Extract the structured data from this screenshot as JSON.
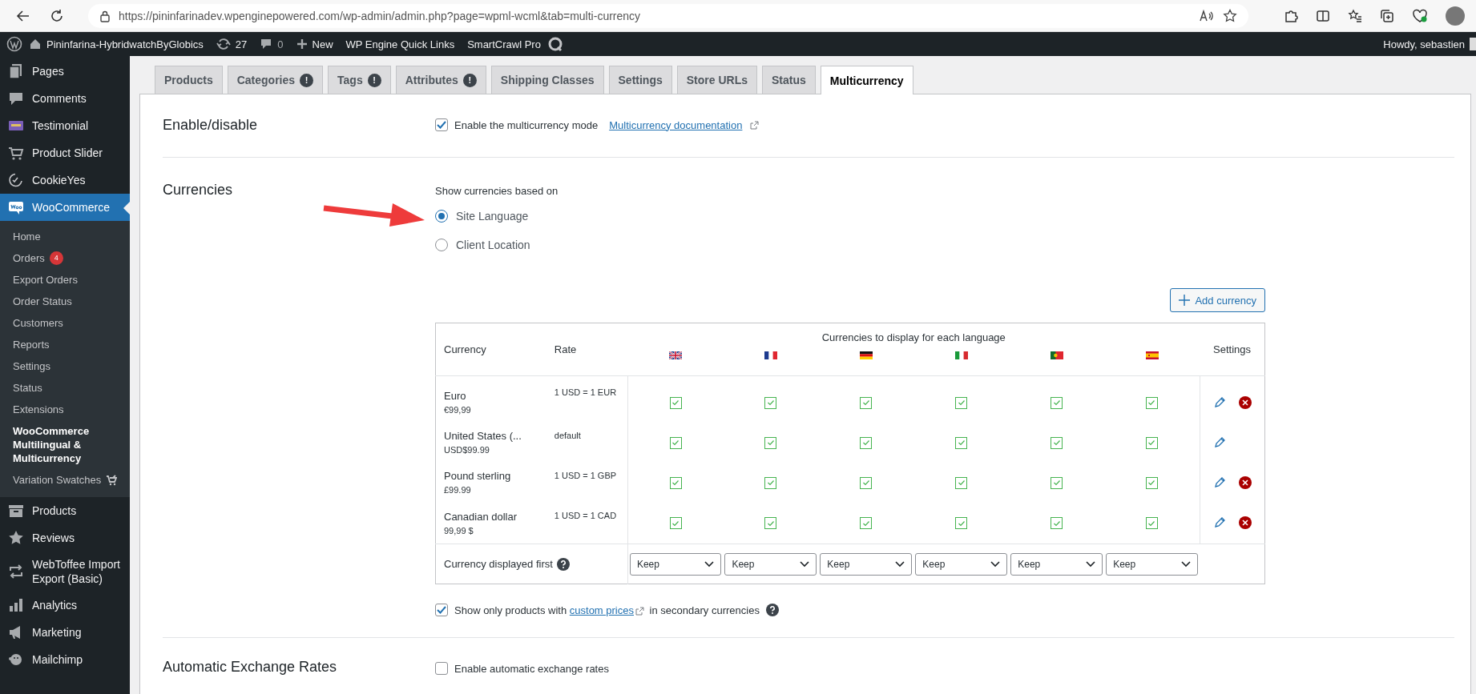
{
  "browser": {
    "url": "https://pininfarinadev.wpenginepowered.com/wp-admin/admin.php?page=wpml-wcml&tab=multi-currency"
  },
  "admin_bar": {
    "site_name": "Pininfarina-HybridwatchByGlobics",
    "updates": "27",
    "comments": "0",
    "new": "New",
    "links": [
      "WP Engine Quick Links",
      "SmartCrawl Pro"
    ],
    "greeting": "Howdy, sebastien"
  },
  "sidebar": {
    "items": [
      {
        "label": "Pages",
        "selected": false
      },
      {
        "label": "Comments",
        "selected": false
      },
      {
        "label": "Testimonial",
        "selected": false
      },
      {
        "label": "Product Slider",
        "selected": false
      },
      {
        "label": "CookieYes",
        "selected": false
      },
      {
        "label": "WooCommerce",
        "selected": true,
        "children": [
          {
            "label": "Home",
            "selected": false
          },
          {
            "label": "Orders",
            "selected": false,
            "badge": "4"
          },
          {
            "label": "Export Orders",
            "selected": false
          },
          {
            "label": "Order Status",
            "selected": false
          },
          {
            "label": "Customers",
            "selected": false
          },
          {
            "label": "Reports",
            "selected": false
          },
          {
            "label": "Settings",
            "selected": false
          },
          {
            "label": "Status",
            "selected": false
          },
          {
            "label": "Extensions",
            "selected": false
          },
          {
            "label": "WooCommerce Multilingual & Multicurrency",
            "selected": true
          },
          {
            "label": "Variation Swatches",
            "selected": false
          }
        ]
      },
      {
        "label": "Products",
        "selected": false
      },
      {
        "label": "Reviews",
        "selected": false
      },
      {
        "label": "WebToffee Import Export (Basic)",
        "selected": false
      },
      {
        "label": "Analytics",
        "selected": false
      },
      {
        "label": "Marketing",
        "selected": false
      },
      {
        "label": "Mailchimp",
        "selected": false
      }
    ]
  },
  "tabs": [
    {
      "label": "Products",
      "selected": false
    },
    {
      "label": "Categories",
      "selected": false,
      "badge": "!"
    },
    {
      "label": "Tags",
      "selected": false,
      "badge": "!"
    },
    {
      "label": "Attributes",
      "selected": false,
      "badge": "!"
    },
    {
      "label": "Shipping Classes",
      "selected": false
    },
    {
      "label": "Settings",
      "selected": false
    },
    {
      "label": "Store URLs",
      "selected": false
    },
    {
      "label": "Status",
      "selected": false
    },
    {
      "label": "Multicurrency",
      "selected": true
    }
  ],
  "enable": {
    "heading": "Enable/disable",
    "label": "Enable the multicurrency mode",
    "checked": true,
    "link": "Multicurrency documentation"
  },
  "currencies": {
    "heading": "Currencies",
    "mode_label": "Show currencies based on",
    "modes": [
      {
        "label": "Site Language",
        "selected": true
      },
      {
        "label": "Client Location",
        "selected": false
      }
    ],
    "add_button": "Add currency",
    "table": {
      "columns": [
        "Currency",
        "Rate"
      ],
      "languages_heading": "Currencies to display for each language",
      "settings_heading": "Settings",
      "rows": [
        {
          "name": "Euro",
          "price": "€99,99",
          "rate": "1 USD = 1 EUR",
          "enabled": [
            true,
            true,
            true,
            true,
            true,
            true
          ],
          "removable": true
        },
        {
          "name": "United States (...",
          "price": "USD$99.99",
          "rate": "default",
          "enabled": [
            true,
            true,
            true,
            true,
            true,
            true
          ],
          "removable": false
        },
        {
          "name": "Pound sterling",
          "price": "£99.99",
          "rate": "1 USD = 1 GBP",
          "enabled": [
            true,
            true,
            true,
            true,
            true,
            true
          ],
          "removable": true
        },
        {
          "name": "Canadian dollar",
          "price": "99,99 $",
          "rate": "1 USD = 1 CAD",
          "enabled": [
            true,
            true,
            true,
            true,
            true,
            true
          ],
          "removable": true
        }
      ],
      "display_first": {
        "label": "Currency displayed first",
        "selects": [
          "Keep",
          "Keep",
          "Keep",
          "Keep",
          "Keep",
          "Keep"
        ]
      }
    },
    "products_option": {
      "checked": true,
      "before": "Show only products with ",
      "link": "custom prices",
      "after": " in secondary currencies"
    }
  },
  "exchange": {
    "heading": "Automatic Exchange Rates",
    "label": "Enable automatic exchange rates",
    "checked": false
  }
}
